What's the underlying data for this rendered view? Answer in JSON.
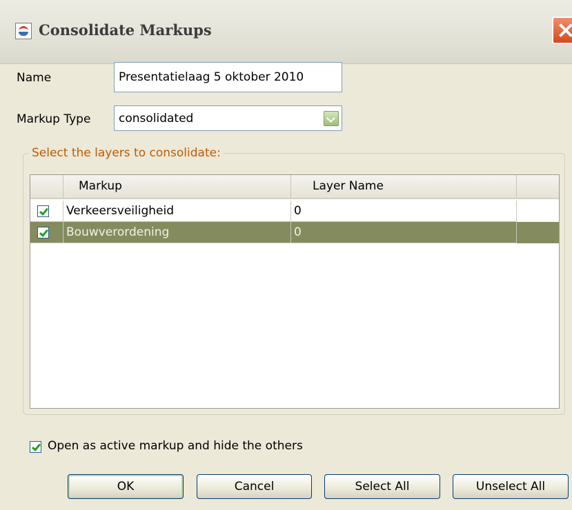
{
  "window": {
    "title": "Consolidate Markups"
  },
  "form": {
    "name_label": "Name",
    "name_value": "Presentatielaag 5 oktober 2010",
    "markup_type_label": "Markup Type",
    "markup_type_value": "consolidated"
  },
  "layers": {
    "group_title": "Select the layers to consolidate:",
    "columns": [
      "",
      "Markup",
      "Layer Name"
    ],
    "rows": [
      {
        "checked": true,
        "markup": "Verkeersveiligheid",
        "layer_name": "0"
      },
      {
        "checked": true,
        "markup": "Bouwverordening",
        "layer_name": "0"
      }
    ]
  },
  "options": {
    "open_active_label": "Open as active markup and hide the others",
    "open_active_checked": true
  },
  "buttons": {
    "ok": "OK",
    "cancel": "Cancel",
    "select_all": "Select All",
    "unselect_all": "Unselect All"
  },
  "colors": {
    "selected_row": "#848c5f",
    "group_title": "#c15b00",
    "border": "#7f9db9"
  },
  "icons": {
    "app": "java-cup-icon",
    "close": "close-icon",
    "dropdown": "chevron-down-icon",
    "check": "check-icon"
  }
}
